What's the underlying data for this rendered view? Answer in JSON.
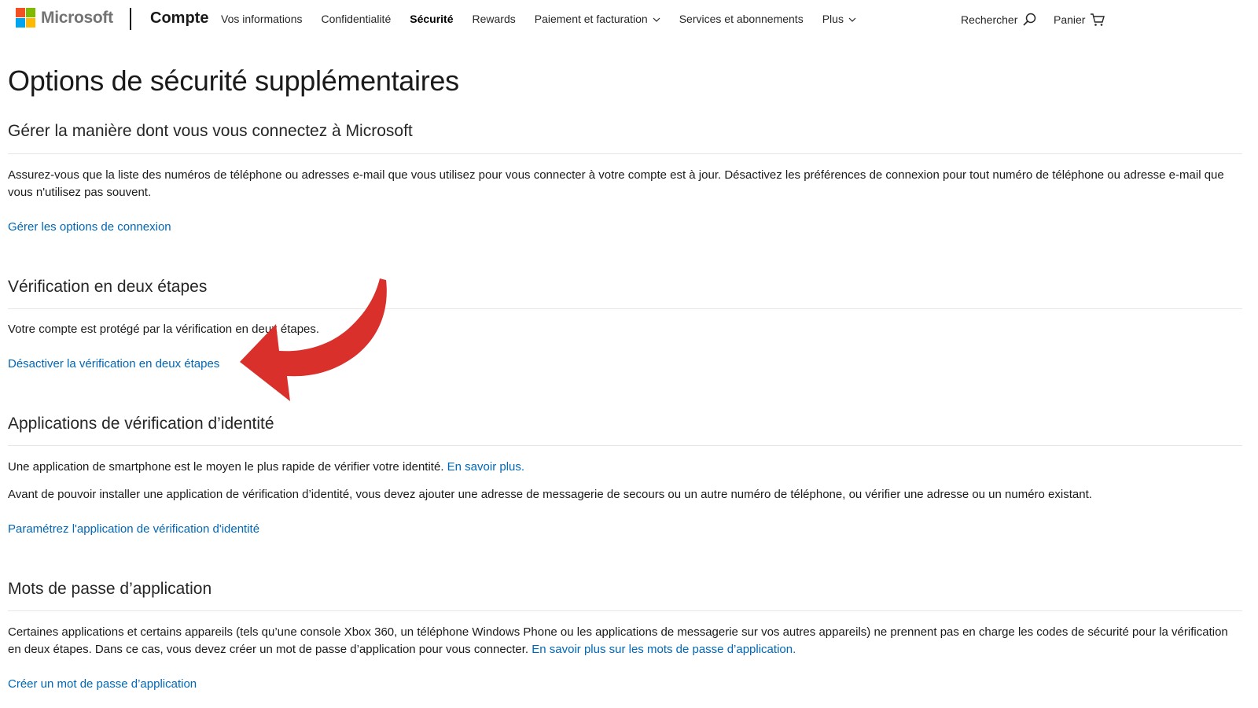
{
  "header": {
    "brand": "Microsoft",
    "brand_colors": [
      "#f25022",
      "#7fba00",
      "#00a4ef",
      "#ffb900"
    ],
    "section": "Compte",
    "nav": [
      {
        "label": "Vos informations",
        "active": false,
        "dropdown": false
      },
      {
        "label": "Confidentialité",
        "active": false,
        "dropdown": false
      },
      {
        "label": "Sécurité",
        "active": true,
        "dropdown": false
      },
      {
        "label": "Rewards",
        "active": false,
        "dropdown": false
      },
      {
        "label": "Paiement et facturation",
        "active": false,
        "dropdown": true
      },
      {
        "label": "Services et abonnements",
        "active": false,
        "dropdown": false
      },
      {
        "label": "Plus",
        "active": false,
        "dropdown": true
      }
    ],
    "search_label": "Rechercher",
    "search_icon": "search-icon",
    "cart_label": "Panier",
    "cart_icon": "cart-icon"
  },
  "page": {
    "title": "Options de sécurité supplémentaires"
  },
  "sections": {
    "signin": {
      "title": "Gérer la manière dont vous vous connectez à Microsoft",
      "text": "Assurez-vous que la liste des numéros de téléphone ou adresses e-mail que vous utilisez pour vous connecter à votre compte est à jour. Désactivez les préférences de connexion pour tout numéro de téléphone ou adresse e-mail que vous n'utilisez pas souvent.",
      "link": "Gérer les options de connexion"
    },
    "two_step": {
      "title": "Vérification en deux étapes",
      "text": "Votre compte est protégé par la vérification en deux étapes.",
      "link": "Désactiver la vérification en deux étapes"
    },
    "auth_apps": {
      "title": "Applications de vérification d’identité",
      "text1": "Une application de smartphone est le moyen le plus rapide de vérifier votre identité.",
      "text1_link": "En savoir plus.",
      "text2": "Avant de pouvoir installer une application de vérification d’identité, vous devez ajouter une adresse de messagerie de secours ou un autre numéro de téléphone, ou vérifier une adresse ou un numéro existant.",
      "link": "Paramétrez l'application de vérification d'identité"
    },
    "app_passwords": {
      "title": "Mots de passe d’application",
      "text": "Certaines applications et certains appareils (tels qu’une console Xbox 360, un téléphone Windows Phone ou les applications de messagerie sur vos autres appareils) ne prennent pas en charge les codes de sécurité pour la vérification en deux étapes. Dans ce cas, vous devez créer un mot de passe d’application pour vous connecter.",
      "text_link": "En savoir plus sur les mots de passe d’application.",
      "link": "Créer un mot de passe d’application"
    }
  },
  "annotation": {
    "icon": "red-arrow-icon",
    "color": "#d9302c"
  },
  "colors": {
    "link": "#0067b8",
    "text": "#1a1a1a",
    "rule": "#e6e6e6"
  }
}
